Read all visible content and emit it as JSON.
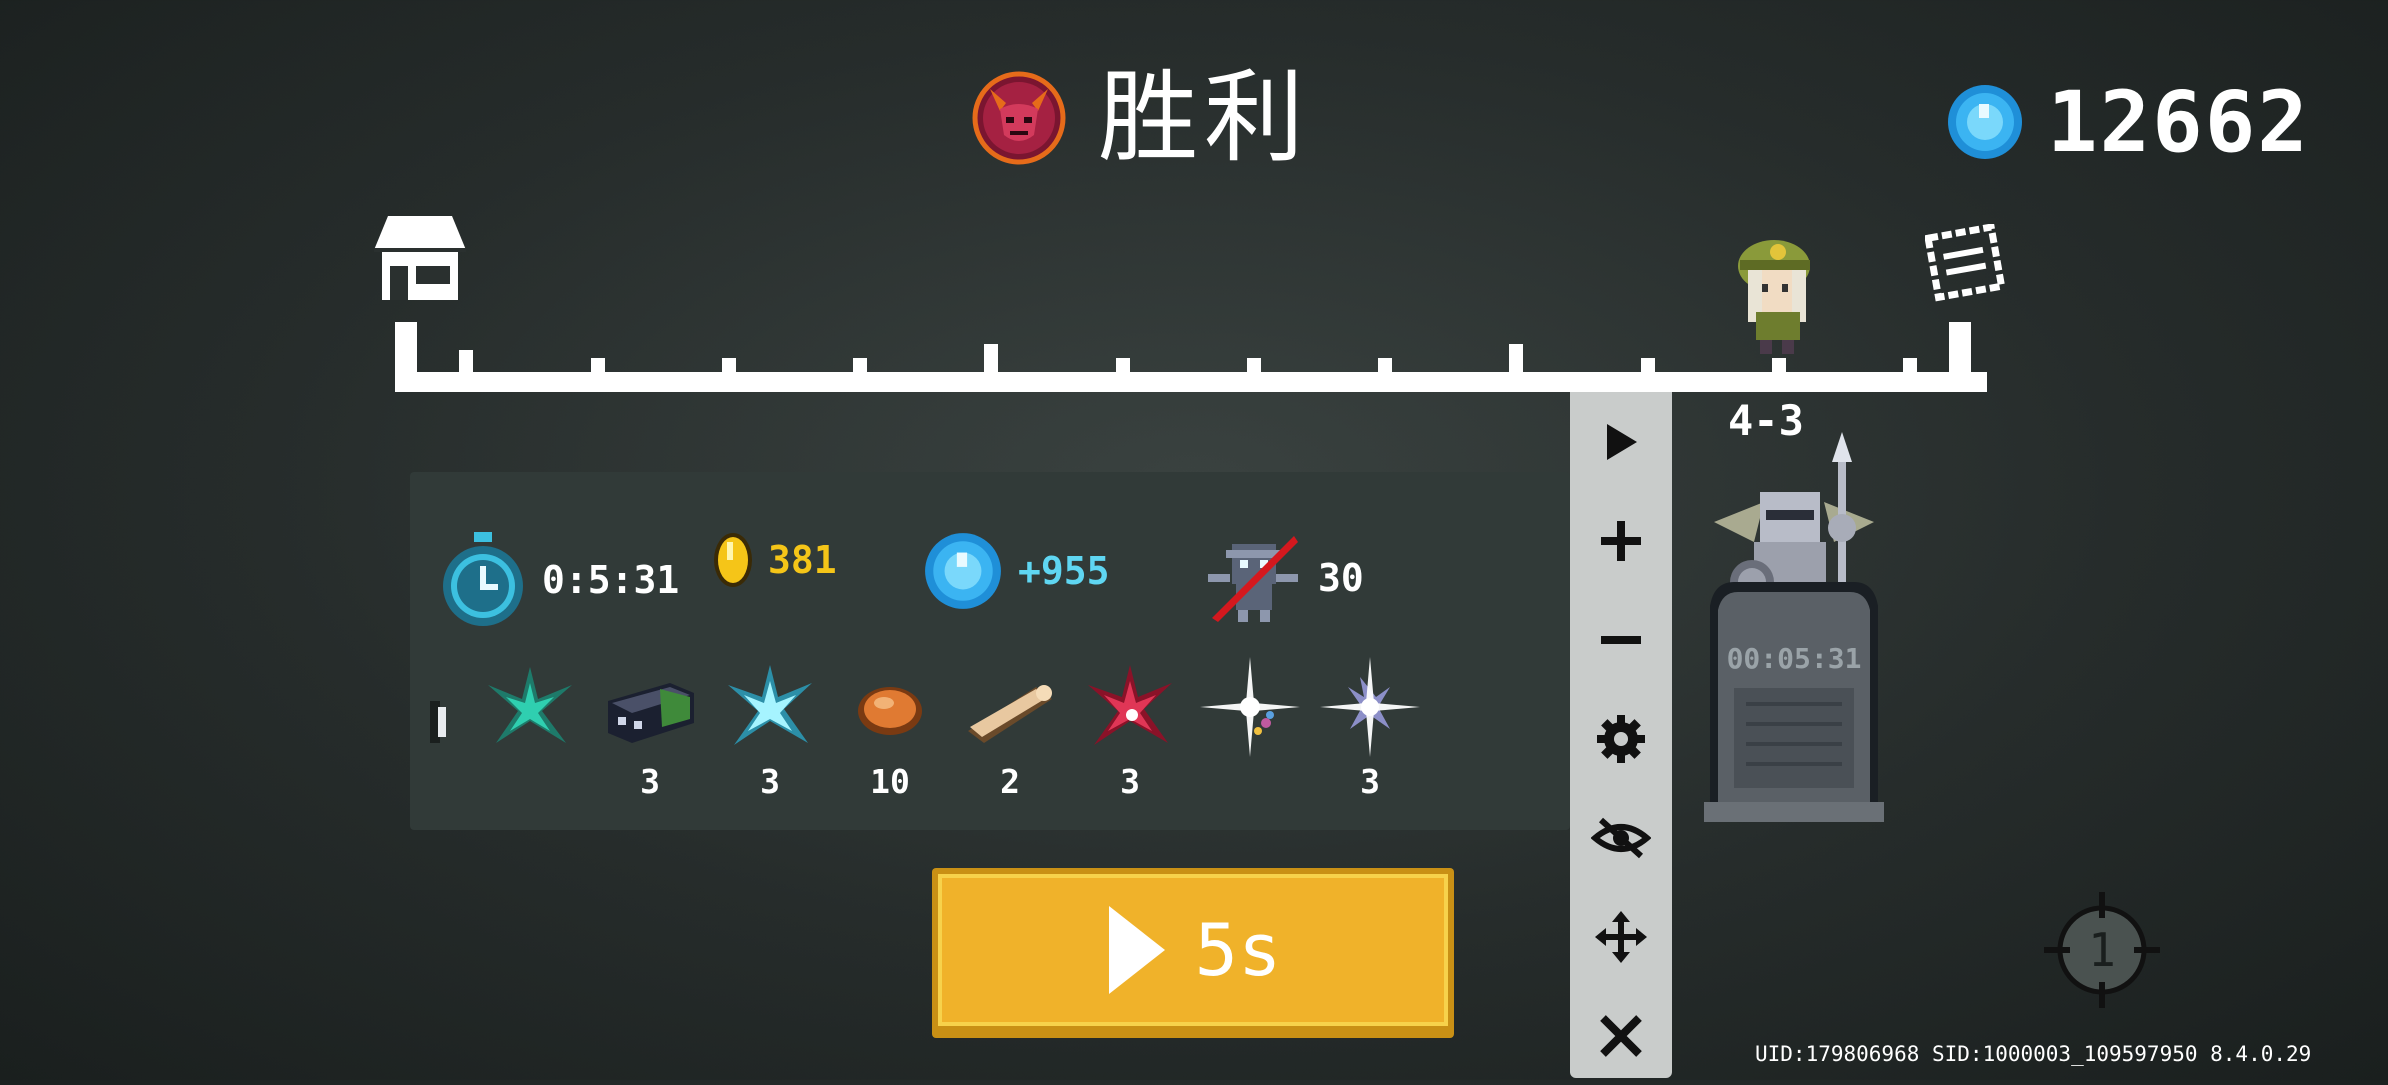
{
  "header": {
    "title": "胜利",
    "currency_value": "12662",
    "currency_icon": "blue-gem-icon",
    "emblem_icon": "red-demon-emblem-icon"
  },
  "progress": {
    "start_icon": "home-icon",
    "end_icon": "portal-icon",
    "player_position": 0.87,
    "level": "4-3"
  },
  "stats": {
    "time": "0:5:31",
    "gold": "381",
    "gems": "+955",
    "kills": "30"
  },
  "items": [
    {
      "icon": "green-leaf-icon",
      "count": ""
    },
    {
      "icon": "metal-ore-block-icon",
      "count": "3"
    },
    {
      "icon": "cyan-crystal-icon",
      "count": "3"
    },
    {
      "icon": "meat-icon",
      "count": "10"
    },
    {
      "icon": "wood-log-icon",
      "count": "2"
    },
    {
      "icon": "red-crystal-icon",
      "count": "3"
    },
    {
      "icon": "sparkle-flower-icon",
      "count": ""
    },
    {
      "icon": "sparkle-crystal-icon",
      "count": "3"
    }
  ],
  "toolbar": [
    "play-icon",
    "plus-icon",
    "minus-icon",
    "gear-icon",
    "eye-off-icon",
    "move-icon",
    "close-icon"
  ],
  "continue_button": {
    "label": "5s"
  },
  "tombstone": {
    "time": "00:05:31"
  },
  "footer": {
    "uid_text": "UID:179806968 SID:1000003_109597950 8.4.0.29"
  },
  "crosshair_number": "1",
  "colors": {
    "gold_text": "#f5c518",
    "gem_text": "#5fd6f2",
    "button_yellow": "#f0b22a",
    "panel": "#313a38"
  }
}
